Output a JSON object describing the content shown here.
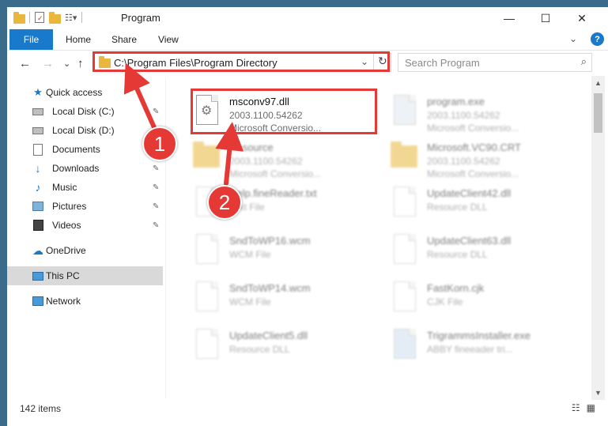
{
  "window": {
    "title": "Program",
    "controls": {
      "minimize": "—",
      "maximize": "☐",
      "close": "✕"
    }
  },
  "ribbon": {
    "tabs": [
      {
        "label": "File"
      },
      {
        "label": "Home"
      },
      {
        "label": "Share"
      },
      {
        "label": "View"
      }
    ],
    "expand": "⌄",
    "help": "?"
  },
  "navigation": {
    "back": "←",
    "forward": "→",
    "recent": "⌄",
    "up": "↑",
    "address": "C:\\Program Files\\Program Directory",
    "address_dropdown": "⌄",
    "refresh": "↻",
    "search_placeholder": "Search Program",
    "search_icon": "⌕"
  },
  "sidebar": {
    "items": [
      {
        "label": "Quick access",
        "icon": "star-icon",
        "pinned": false
      },
      {
        "label": "Local Disk (C:)",
        "icon": "drive-icon",
        "pinned": true
      },
      {
        "label": "Local Disk (D:)",
        "icon": "drive-icon",
        "pinned": false
      },
      {
        "label": "Documents",
        "icon": "documents-icon",
        "pinned": false
      },
      {
        "label": "Downloads",
        "icon": "download-icon",
        "pinned": true
      },
      {
        "label": "Music",
        "icon": "music-icon",
        "pinned": true
      },
      {
        "label": "Pictures",
        "icon": "pictures-icon",
        "pinned": true
      },
      {
        "label": "Videos",
        "icon": "videos-icon",
        "pinned": true
      },
      {
        "label": "OneDrive",
        "icon": "cloud-icon",
        "pinned": false
      },
      {
        "label": "This PC",
        "icon": "computer-icon",
        "pinned": false,
        "selected": true
      },
      {
        "label": "Network",
        "icon": "network-icon",
        "pinned": false
      }
    ],
    "pin_glyph": "📌"
  },
  "files": [
    {
      "name": "msconv97.dll",
      "line1": "2003.1100.54262",
      "line2": "Microsoft Conversio...",
      "icon": "dll-gear-icon",
      "highlighted": true
    },
    {
      "name": "program.exe",
      "line1": "2003.1100.54262",
      "line2": "Microsoft Conversio...",
      "icon": "exe-icon"
    },
    {
      "name": "Resource",
      "line1": "2003.1100.54262",
      "line2": "Microsoft Conversio...",
      "icon": "folder-icon"
    },
    {
      "name": "Microsoft.VC90.CRT",
      "line1": "2003.1100.54262",
      "line2": "Microsoft Conversio...",
      "icon": "folder-icon"
    },
    {
      "name": "Help.fineReader.txt",
      "line1": "Text File",
      "line2": "",
      "icon": "text-file-icon"
    },
    {
      "name": "UpdateClient42.dll",
      "line1": "Resource DLL",
      "line2": "",
      "icon": "dll-gear-icon"
    },
    {
      "name": "SndToWP16.wcm",
      "line1": "WCM File",
      "line2": "",
      "icon": "blank-file-icon"
    },
    {
      "name": "UpdateClient63.dll",
      "line1": "Resource DLL",
      "line2": "",
      "icon": "dll-gear-icon"
    },
    {
      "name": "SndToWP14.wcm",
      "line1": "WCM File",
      "line2": "",
      "icon": "blank-file-icon"
    },
    {
      "name": "FastKorn.cjk",
      "line1": "CJK File",
      "line2": "",
      "icon": "blank-file-icon"
    },
    {
      "name": "UpdateClient5.dll",
      "line1": "Resource DLL",
      "line2": "",
      "icon": "dll-gear-icon"
    },
    {
      "name": "TrigrammsInstaller.exe",
      "line1": "ABBY fineeader tri...",
      "line2": "",
      "icon": "installer-icon"
    }
  ],
  "status": {
    "item_count": "142 items",
    "details_view": "☷",
    "large_icons_view": "▦"
  },
  "callouts": [
    {
      "label": "1"
    },
    {
      "label": "2"
    }
  ],
  "colors": {
    "accent": "#1979ca",
    "annotation_red": "#e53935",
    "folder": "#e8b73b",
    "selected": "#d9d9d9"
  }
}
